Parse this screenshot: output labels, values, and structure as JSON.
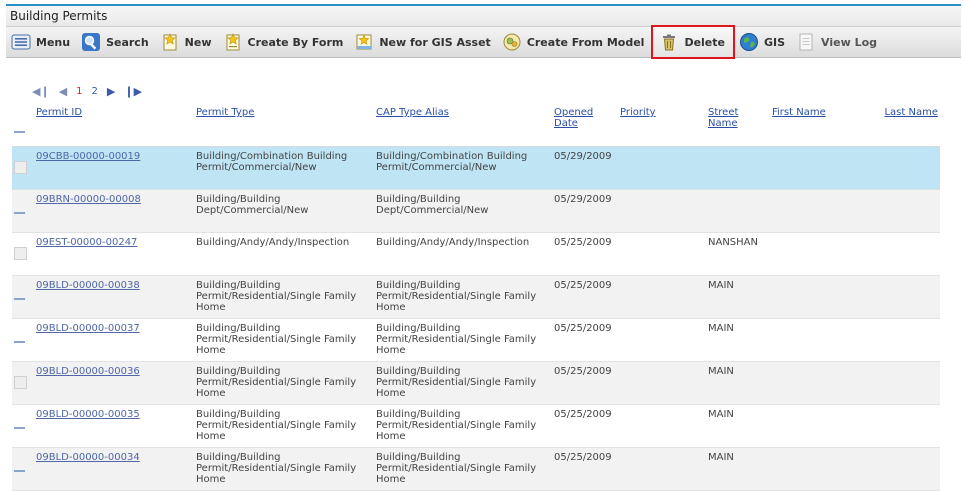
{
  "window": {
    "title": "Building Permits"
  },
  "toolbar": {
    "items": [
      {
        "label": "Menu",
        "icon": "menu-icon"
      },
      {
        "label": "Search",
        "icon": "search-icon"
      },
      {
        "label": "New",
        "icon": "new-document-icon"
      },
      {
        "label": "Create By Form",
        "icon": "create-form-icon"
      },
      {
        "label": "New for GIS Asset",
        "icon": "gis-asset-icon"
      },
      {
        "label": "Create From Model",
        "icon": "model-icon"
      },
      {
        "label": "Delete",
        "icon": "trash-icon",
        "highlighted": true
      },
      {
        "label": "GIS",
        "icon": "globe-icon"
      },
      {
        "label": "View Log",
        "icon": "log-icon"
      }
    ]
  },
  "pager": {
    "pages": [
      "1",
      "2"
    ],
    "current": "1"
  },
  "table": {
    "columns": [
      "Permit ID",
      "Permit Type",
      "CAP Type Alias",
      "Opened Date",
      "Priority",
      "Street Name",
      "First Name",
      "Last Name"
    ],
    "rows": [
      {
        "permit_id": "09CBB-00000-00019",
        "permit_type": "Building/Combination Building Permit/Commercial/New",
        "cap_alias": "Building/Combination Building Permit/Commercial/New",
        "opened": "05/29/2009",
        "priority": "",
        "street": "",
        "first": "",
        "last": "",
        "state": "selected"
      },
      {
        "permit_id": "09BRN-00000-00008",
        "permit_type": "Building/Building Dept/Commercial/New",
        "cap_alias": "Building/Building Dept/Commercial/New",
        "opened": "05/29/2009",
        "priority": "",
        "street": "",
        "first": "",
        "last": "",
        "state": "alt"
      },
      {
        "permit_id": "09EST-00000-00247",
        "permit_type": "Building/Andy/Andy/Inspection",
        "cap_alias": "Building/Andy/Andy/Inspection",
        "opened": "05/25/2009",
        "priority": "",
        "street": "NANSHAN",
        "first": "",
        "last": "",
        "state": "normal"
      },
      {
        "permit_id": "09BLD-00000-00038",
        "permit_type": "Building/Building Permit/Residential/Single Family Home",
        "cap_alias": "Building/Building Permit/Residential/Single Family Home",
        "opened": "05/25/2009",
        "priority": "",
        "street": "MAIN",
        "first": "",
        "last": "",
        "state": "alt"
      },
      {
        "permit_id": "09BLD-00000-00037",
        "permit_type": "Building/Building Permit/Residential/Single Family Home",
        "cap_alias": "Building/Building Permit/Residential/Single Family Home",
        "opened": "05/25/2009",
        "priority": "",
        "street": "MAIN",
        "first": "",
        "last": "",
        "state": "normal"
      },
      {
        "permit_id": "09BLD-00000-00036",
        "permit_type": "Building/Building Permit/Residential/Single Family Home",
        "cap_alias": "Building/Building Permit/Residential/Single Family Home",
        "opened": "05/25/2009",
        "priority": "",
        "street": "MAIN",
        "first": "",
        "last": "",
        "state": "alt"
      },
      {
        "permit_id": "09BLD-00000-00035",
        "permit_type": "Building/Building Permit/Residential/Single Family Home",
        "cap_alias": "Building/Building Permit/Residential/Single Family Home",
        "opened": "05/25/2009",
        "priority": "",
        "street": "MAIN",
        "first": "",
        "last": "",
        "state": "normal"
      },
      {
        "permit_id": "09BLD-00000-00034",
        "permit_type": "Building/Building Permit/Residential/Single Family Home",
        "cap_alias": "Building/Building Permit/Residential/Single Family Home",
        "opened": "05/25/2009",
        "priority": "",
        "street": "MAIN",
        "first": "",
        "last": "",
        "state": "alt"
      }
    ]
  },
  "colors": {
    "accent_border": "#2a92c8",
    "link": "#2b4fa5",
    "selected_row": "#bfe4f3",
    "highlight_box": "#e0141d"
  }
}
